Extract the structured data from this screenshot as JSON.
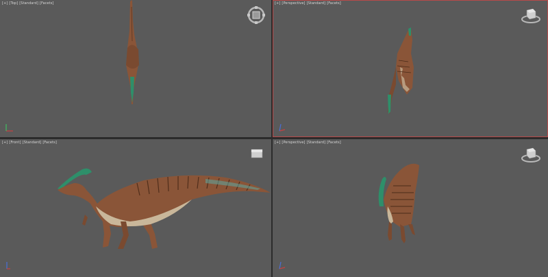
{
  "app": {
    "active_viewport": "perspective-top-right"
  },
  "viewports": [
    {
      "id": "top",
      "labels": [
        "[+]",
        "[Top]",
        "[Standard]",
        "[Facets]"
      ]
    },
    {
      "id": "persp-1",
      "labels": [
        "[+]",
        "[Perspective]",
        "[Standard]",
        "[Facets]"
      ]
    },
    {
      "id": "front",
      "labels": [
        "[+]",
        "[Front]",
        "[Standard]",
        "[Facets]"
      ]
    },
    {
      "id": "persp-2",
      "labels": [
        "[+]",
        "[Perspective]",
        "[Standard]",
        "[Facets]"
      ]
    }
  ],
  "colors": {
    "viewport_bg": "#5a5a5a",
    "divider": "#2b2b2b",
    "active_border": "#b84a4a",
    "dino_body": "#8a5538",
    "dino_belly": "#c9b79a",
    "dino_crest": "#2e8f6a",
    "axis_x": "#c84040",
    "axis_y": "#3fbf5f",
    "axis_z": "#4a6fd8"
  },
  "icons": [
    "steering-wheel-icon",
    "view-cube-icon",
    "axis-tripod-icon"
  ]
}
